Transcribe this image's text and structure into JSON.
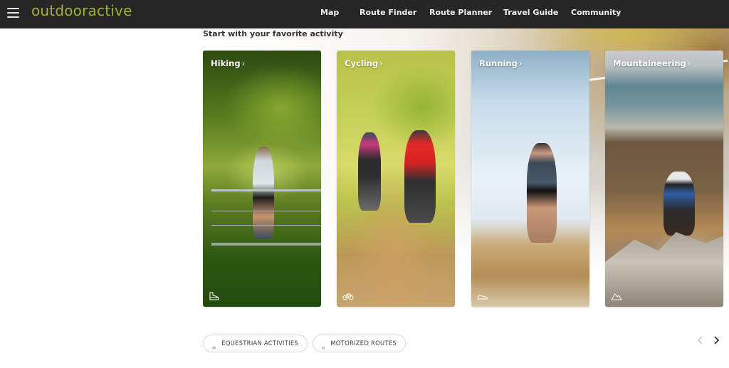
{
  "header": {
    "menu_icon": "hamburger-icon",
    "logo": "outdooractive",
    "brand_color": "#a2b02f",
    "nav": [
      {
        "label": "Map"
      },
      {
        "label": "Route Finder"
      },
      {
        "label": "Route Planner"
      },
      {
        "label": "Travel Guide"
      },
      {
        "label": "Community"
      }
    ]
  },
  "main": {
    "section_title": "Start with your favorite activity",
    "cards": [
      {
        "label": "Hiking",
        "chevron": "›",
        "icon": "hiking-boot-icon"
      },
      {
        "label": "Cycling",
        "chevron": "›",
        "icon": "bicycle-icon"
      },
      {
        "label": "Running",
        "chevron": "›",
        "icon": "running-shoe-icon"
      },
      {
        "label": "Mountaineering",
        "chevron": "›",
        "icon": "mountain-icon"
      }
    ],
    "pills": [
      {
        "label": "EQUESTRIAN ACTIVITIES",
        "icon": "horse-icon"
      },
      {
        "label": "MOTORIZED ROUTES",
        "icon": "motorized-route-icon"
      }
    ],
    "carousel": {
      "prev_icon": "chevron-left-icon",
      "next_icon": "chevron-right-icon"
    }
  }
}
